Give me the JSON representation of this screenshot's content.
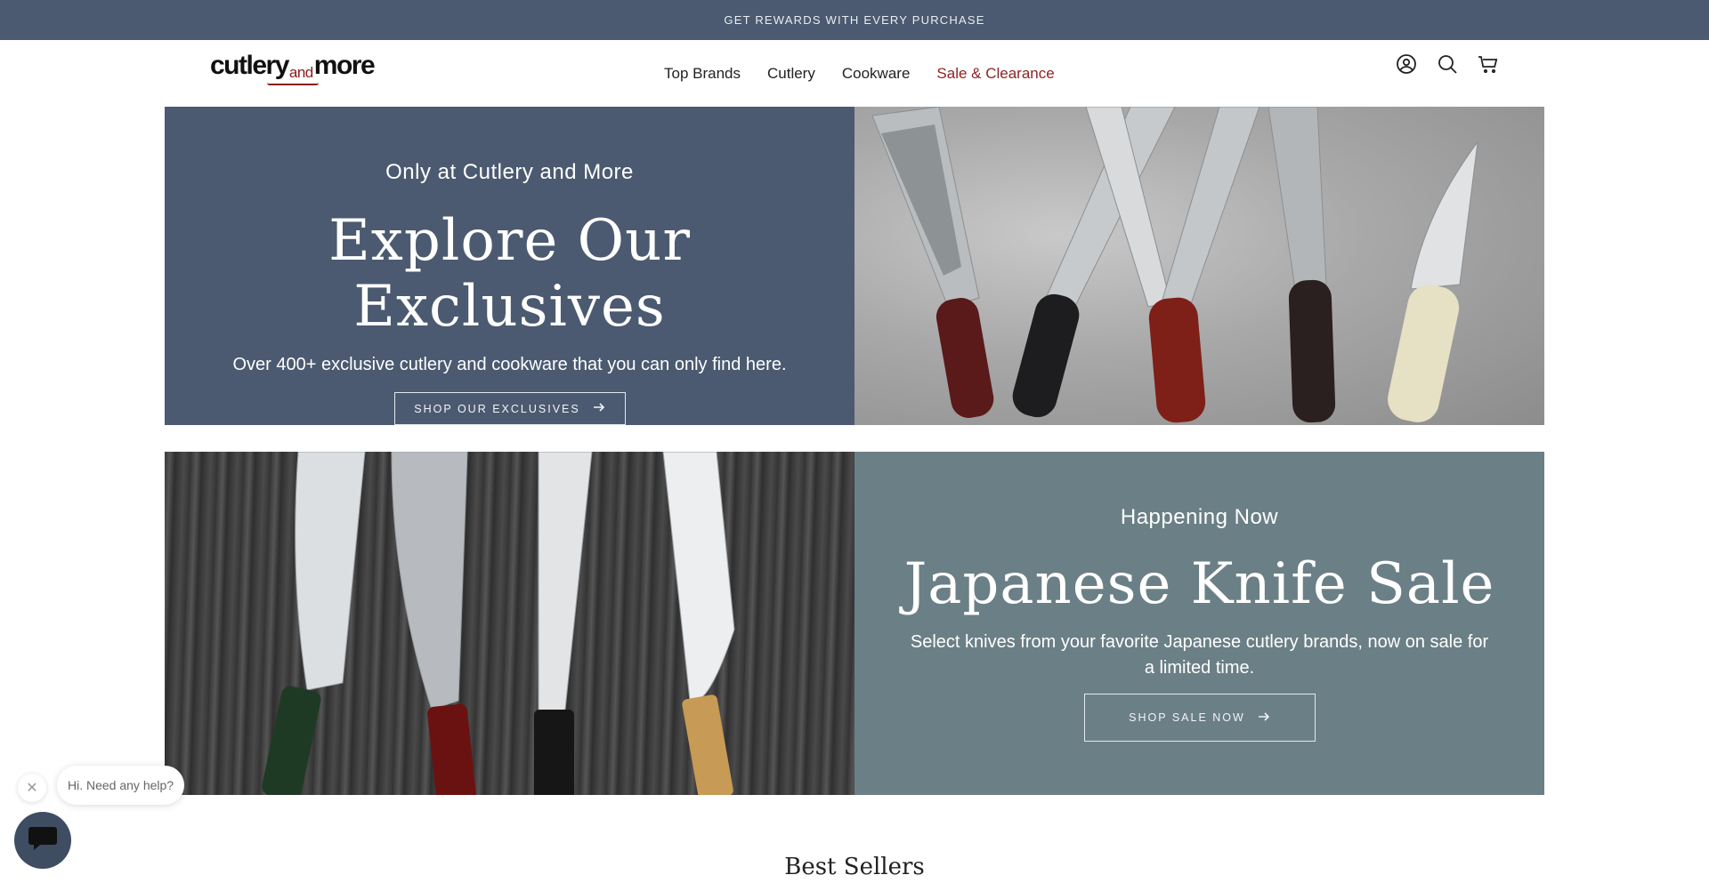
{
  "announcement": "GET REWARDS WITH EVERY PURCHASE",
  "logo": {
    "part1": "cutlery",
    "part2": "and",
    "part3": "more"
  },
  "nav": [
    {
      "label": "Top Brands"
    },
    {
      "label": "Cutlery"
    },
    {
      "label": "Cookware"
    },
    {
      "label": "Sale & Clearance"
    }
  ],
  "header_icons": [
    "account-icon",
    "search-icon",
    "cart-icon"
  ],
  "banner1": {
    "eyebrow": "Only at Cutlery and More",
    "headline": "Explore Our Exclusives",
    "sub": "Over 400+ exclusive cutlery and cookware that you can only find here.",
    "button": "SHOP OUR EXCLUSIVES"
  },
  "banner2": {
    "eyebrow": "Happening Now",
    "headline": "Japanese Knife Sale",
    "sub": "Select knives from your favorite Japanese cutlery brands, now on sale for a limited time.",
    "button": "SHOP SALE NOW"
  },
  "section_title": "Best Sellers",
  "chat": {
    "prompt": "Hi. Need any help?"
  },
  "colors": {
    "announce_bg": "#4b5a70",
    "panel1_bg": "#4b5a70",
    "panel2_bg": "#6b7f86",
    "sale_link": "#8e2323"
  }
}
